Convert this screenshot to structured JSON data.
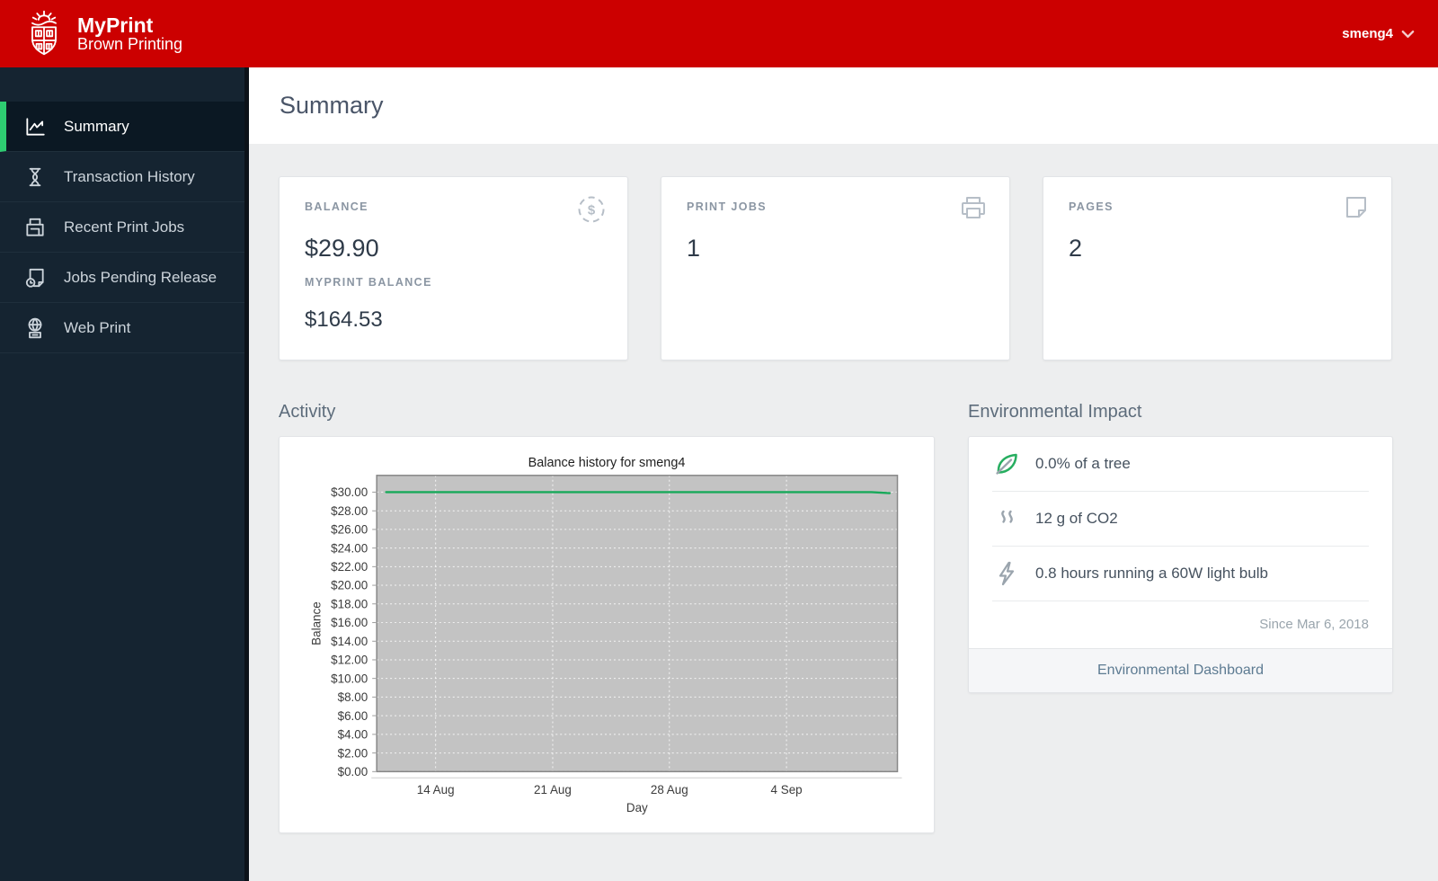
{
  "header": {
    "app_title": "MyPrint",
    "app_subtitle": "Brown Printing",
    "user": "smeng4"
  },
  "sidebar": {
    "items": [
      {
        "label": "Summary",
        "icon": "line-chart-icon",
        "active": true
      },
      {
        "label": "Transaction History",
        "icon": "hourglass-icon",
        "active": false
      },
      {
        "label": "Recent Print Jobs",
        "icon": "printer-tray-icon",
        "active": false
      },
      {
        "label": "Jobs Pending Release",
        "icon": "document-clock-icon",
        "active": false
      },
      {
        "label": "Web Print",
        "icon": "globe-printer-icon",
        "active": false
      }
    ]
  },
  "page": {
    "title": "Summary"
  },
  "cards": {
    "balance": {
      "label": "BALANCE",
      "value": "$29.90",
      "sublabel": "MYPRINT BALANCE",
      "subvalue": "$164.53",
      "icon": "dollar-circle-icon"
    },
    "print_jobs": {
      "label": "PRINT JOBS",
      "value": "1",
      "icon": "printer-icon"
    },
    "pages": {
      "label": "PAGES",
      "value": "2",
      "icon": "page-icon"
    }
  },
  "sections": {
    "activity": "Activity",
    "environment": "Environmental Impact"
  },
  "chart_data": {
    "type": "line",
    "title": "Balance history for smeng4",
    "xlabel": "Day",
    "ylabel": "Balance",
    "ylim": [
      0,
      31.8
    ],
    "grid": true,
    "plot_bg": "#c3c3c3",
    "grid_color": "#fafafa",
    "yticks": [
      {
        "value": 0,
        "label": "$0.00"
      },
      {
        "value": 2,
        "label": "$2.00"
      },
      {
        "value": 4,
        "label": "$4.00"
      },
      {
        "value": 6,
        "label": "$6.00"
      },
      {
        "value": 8,
        "label": "$8.00"
      },
      {
        "value": 10,
        "label": "$10.00"
      },
      {
        "value": 12,
        "label": "$12.00"
      },
      {
        "value": 14,
        "label": "$14.00"
      },
      {
        "value": 16,
        "label": "$16.00"
      },
      {
        "value": 18,
        "label": "$18.00"
      },
      {
        "value": 20,
        "label": "$20.00"
      },
      {
        "value": 22,
        "label": "$22.00"
      },
      {
        "value": 24,
        "label": "$24.00"
      },
      {
        "value": 26,
        "label": "$26.00"
      },
      {
        "value": 28,
        "label": "$28.00"
      },
      {
        "value": 30,
        "label": "$30.00"
      }
    ],
    "xticks": [
      {
        "label": "14 Aug",
        "pos": 0.113
      },
      {
        "label": "21 Aug",
        "pos": 0.338
      },
      {
        "label": "28 Aug",
        "pos": 0.562
      },
      {
        "label": "4 Sep",
        "pos": 0.787
      }
    ],
    "series": [
      {
        "name": "balance",
        "color": "#18a95a",
        "points": [
          {
            "pos": 0.018,
            "value": 30.0
          },
          {
            "pos": 0.95,
            "value": 30.0
          },
          {
            "pos": 0.985,
            "value": 29.9
          }
        ]
      }
    ]
  },
  "environment": {
    "rows": [
      {
        "icon": "leaf-icon",
        "text": "0.0% of a tree"
      },
      {
        "icon": "co2-icon",
        "text": "12 g of CO2"
      },
      {
        "icon": "energy-bolt-icon",
        "text": "0.8 hours running a 60W light bulb"
      }
    ],
    "since": "Since Mar 6, 2018",
    "link": "Environmental Dashboard"
  }
}
